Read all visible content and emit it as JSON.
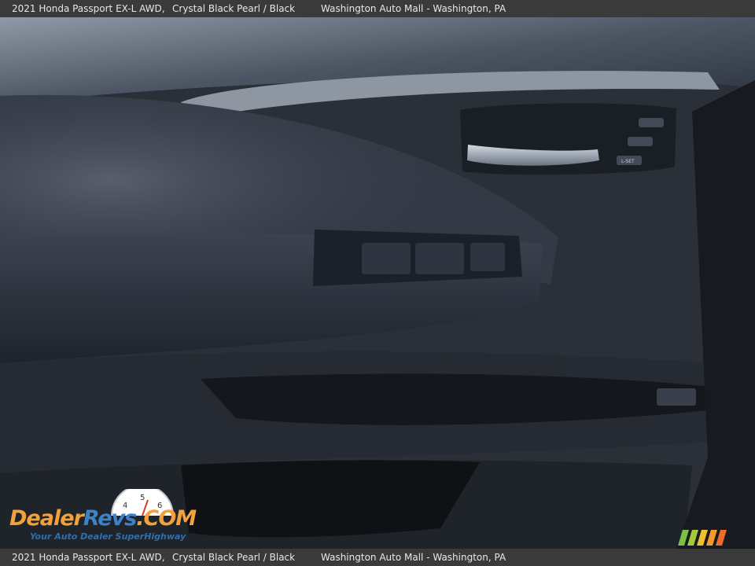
{
  "header": {
    "vehicle": "2021 Honda Passport EX-L AWD,",
    "color": "Crystal Black Pearl / Black",
    "dealer": "Washington Auto Mall - Washington, PA"
  },
  "footer": {
    "vehicle": "2021 Honda Passport EX-L AWD,",
    "color": "Crystal Black Pearl / Black",
    "dealer": "Washington Auto Mall - Washington, PA"
  },
  "watermark": {
    "brand_part1": "Dealer",
    "brand_part2": "Revs",
    "brand_part3": ".COM",
    "tagline": "Your Auto Dealer SuperHighway",
    "gauge_numbers": [
      "4",
      "5",
      "6"
    ]
  },
  "photo": {
    "subject": "door-interior-panel",
    "lock_button_label": "L-SET"
  },
  "colors": {
    "bar_bg": "#3a3a3a",
    "logo_orange": "#f2a23a",
    "logo_blue": "#3d82c6"
  }
}
